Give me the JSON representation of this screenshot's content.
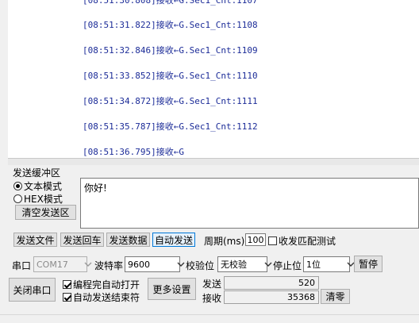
{
  "log": {
    "lines": [
      "[08:51:30.808]接收←G.Sec1_Cnt:1107",
      "[08:51:31.822]接收←G.Sec1_Cnt:1108",
      "[08:51:32.846]接收←G.Sec1_Cnt:1109",
      "[08:51:33.852]接收←G.Sec1_Cnt:1110",
      "[08:51:34.872]接收←G.Sec1_Cnt:1111",
      "[08:51:35.787]接收←G.Sec1_Cnt:1112",
      "[08:51:36.795]接收←G"
    ]
  },
  "send_buffer": {
    "title": "发送缓冲区",
    "mode_text": "文本模式",
    "mode_hex": "HEX模式",
    "clear_button": "清空发送区",
    "content": "你好!"
  },
  "toolbar": {
    "send_file": "发送文件",
    "send_enter": "发送回车",
    "send_data": "发送数据",
    "auto_send": "自动发送",
    "period_label": "周期(ms)",
    "period_value": "100",
    "match_test": "收发匹配测试"
  },
  "serial": {
    "port_label": "串口",
    "port_value": "COM17",
    "baud_label": "波特率",
    "baud_value": "9600",
    "parity_label": "校验位",
    "parity_value": "无校验",
    "stopbit_label": "停止位",
    "stopbit_value": "1位",
    "pause_button": "暂停",
    "close_button": "关闭串口",
    "auto_open": "编程完自动打开",
    "auto_end": "自动发送结束符",
    "more_settings": "更多设置",
    "send_label": "发送",
    "send_count": "520",
    "recv_label": "接收",
    "recv_count": "35368",
    "clear_zero": "清零"
  }
}
